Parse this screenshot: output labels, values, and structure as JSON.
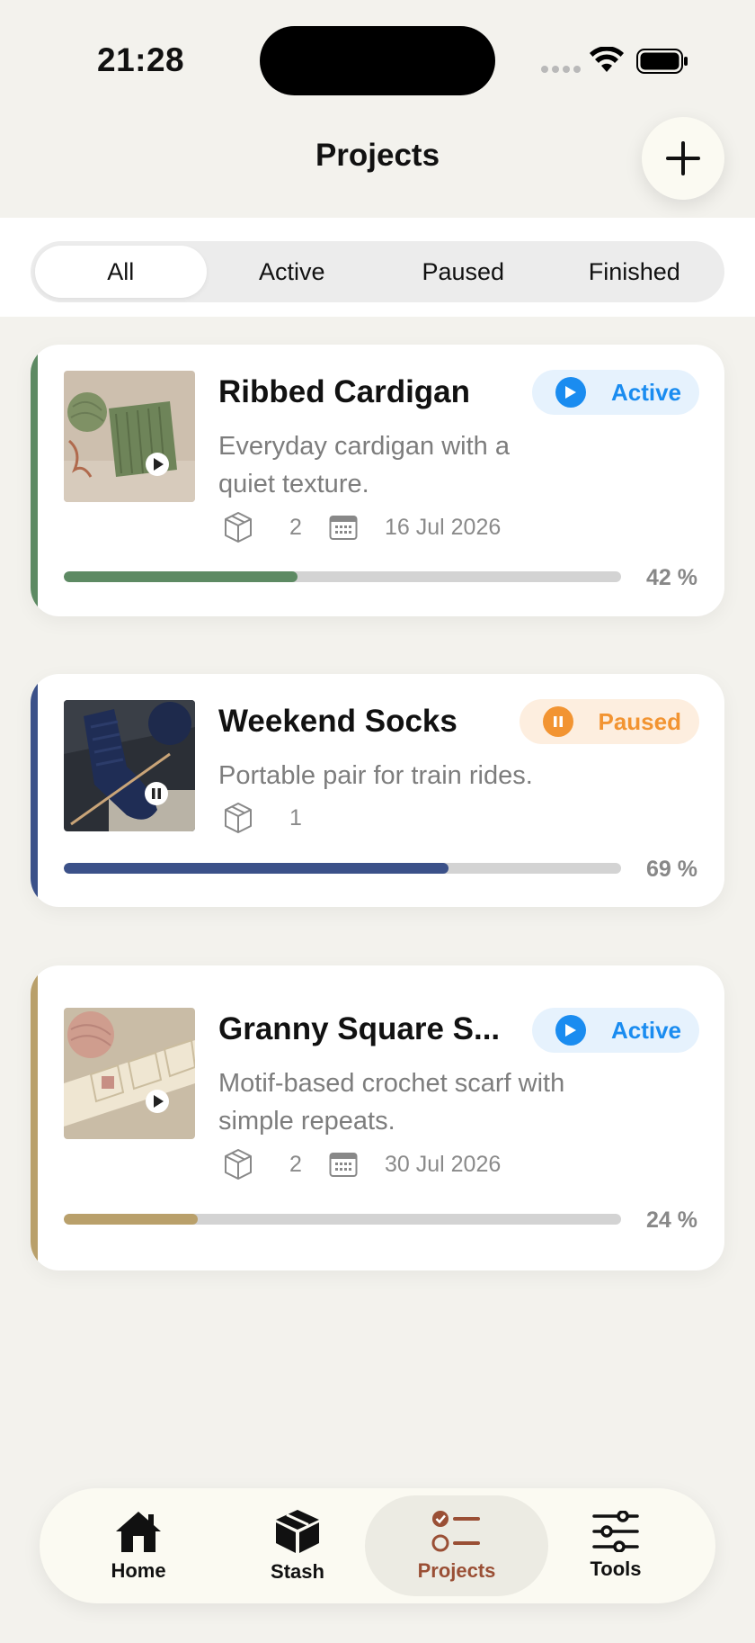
{
  "status_bar": {
    "time": "21:28"
  },
  "header": {
    "title": "Projects",
    "add_icon": "plus-icon"
  },
  "filter": {
    "options": [
      "All",
      "Active",
      "Paused",
      "Finished"
    ],
    "selected": "All"
  },
  "projects": [
    {
      "title": "Ribbed Cardigan",
      "status": "Active",
      "description_line1": "Everyday cardigan with a",
      "description_line2": "quiet texture.",
      "materials": "2",
      "date": "16 Jul 2026",
      "progress": 0.42,
      "progress_label": "42 %",
      "accent": "#5d8a63"
    },
    {
      "title": "Weekend Socks",
      "status": "Paused",
      "description_line1": "Portable pair for train rides.",
      "description_line2": "",
      "materials": "1",
      "date": "",
      "progress": 0.69,
      "progress_label": "69 %",
      "accent": "#3b5189"
    },
    {
      "title": "Granny Square S...",
      "status": "Active",
      "description_line1": "Motif-based crochet scarf with",
      "description_line2": "simple repeats.",
      "materials": "2",
      "date": "30 Jul 2026",
      "progress": 0.24,
      "progress_label": "24 %",
      "accent": "#b9a06b"
    }
  ],
  "status_colors": {
    "active": "#1a8cf0",
    "paused": "#f29432"
  },
  "tab_bar": {
    "items": [
      {
        "label": "Home",
        "icon": "house-icon"
      },
      {
        "label": "Stash",
        "icon": "box-icon"
      },
      {
        "label": "Projects",
        "icon": "checklist-icon"
      },
      {
        "label": "Tools",
        "icon": "sliders-icon"
      }
    ],
    "selected": "Projects",
    "selected_color": "#9a4f35"
  }
}
